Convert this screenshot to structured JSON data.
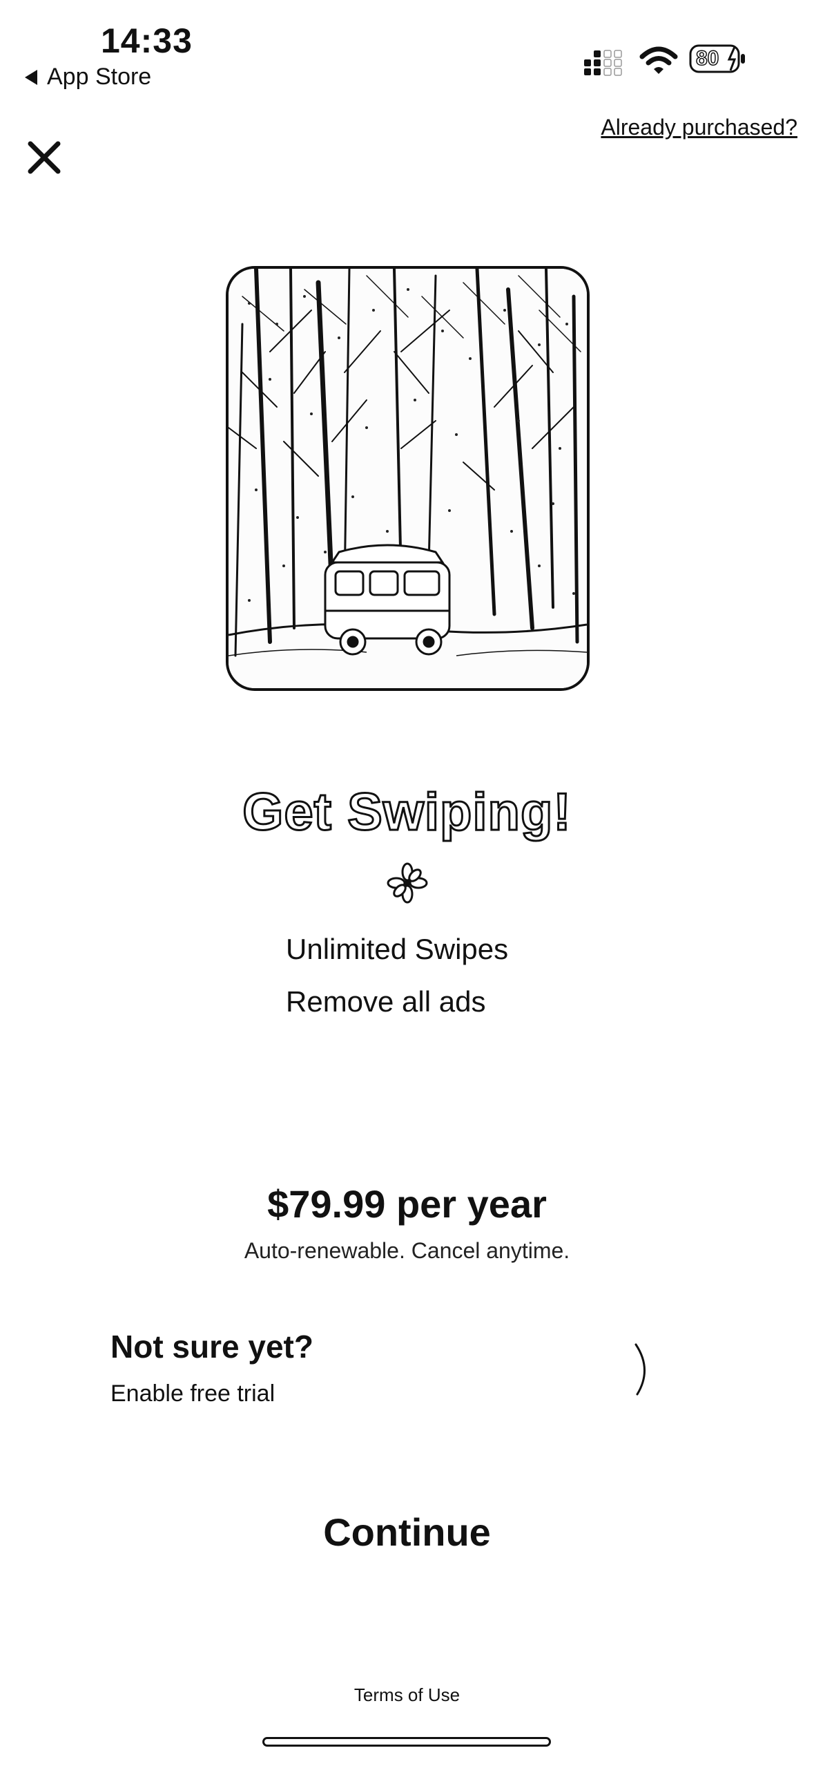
{
  "status_bar": {
    "time": "14:33",
    "back_label": "App Store",
    "battery_level": "80"
  },
  "header": {
    "already_purchased_label": "Already purchased?",
    "close_icon": "close-icon"
  },
  "hero": {
    "image_icon": "snowy-forest-van-image"
  },
  "title": "Get Swiping!",
  "features": [
    "Unlimited Swipes",
    "Remove all ads"
  ],
  "pricing": {
    "price": "$79.99 per year",
    "note": "Auto-renewable. Cancel anytime."
  },
  "trial": {
    "title": "Not sure yet?",
    "subtitle": "Enable free trial"
  },
  "continue_label": "Continue",
  "footer": {
    "terms_label": "Terms of Use"
  },
  "colors": {
    "text": "#111111",
    "background": "#ffffff"
  }
}
